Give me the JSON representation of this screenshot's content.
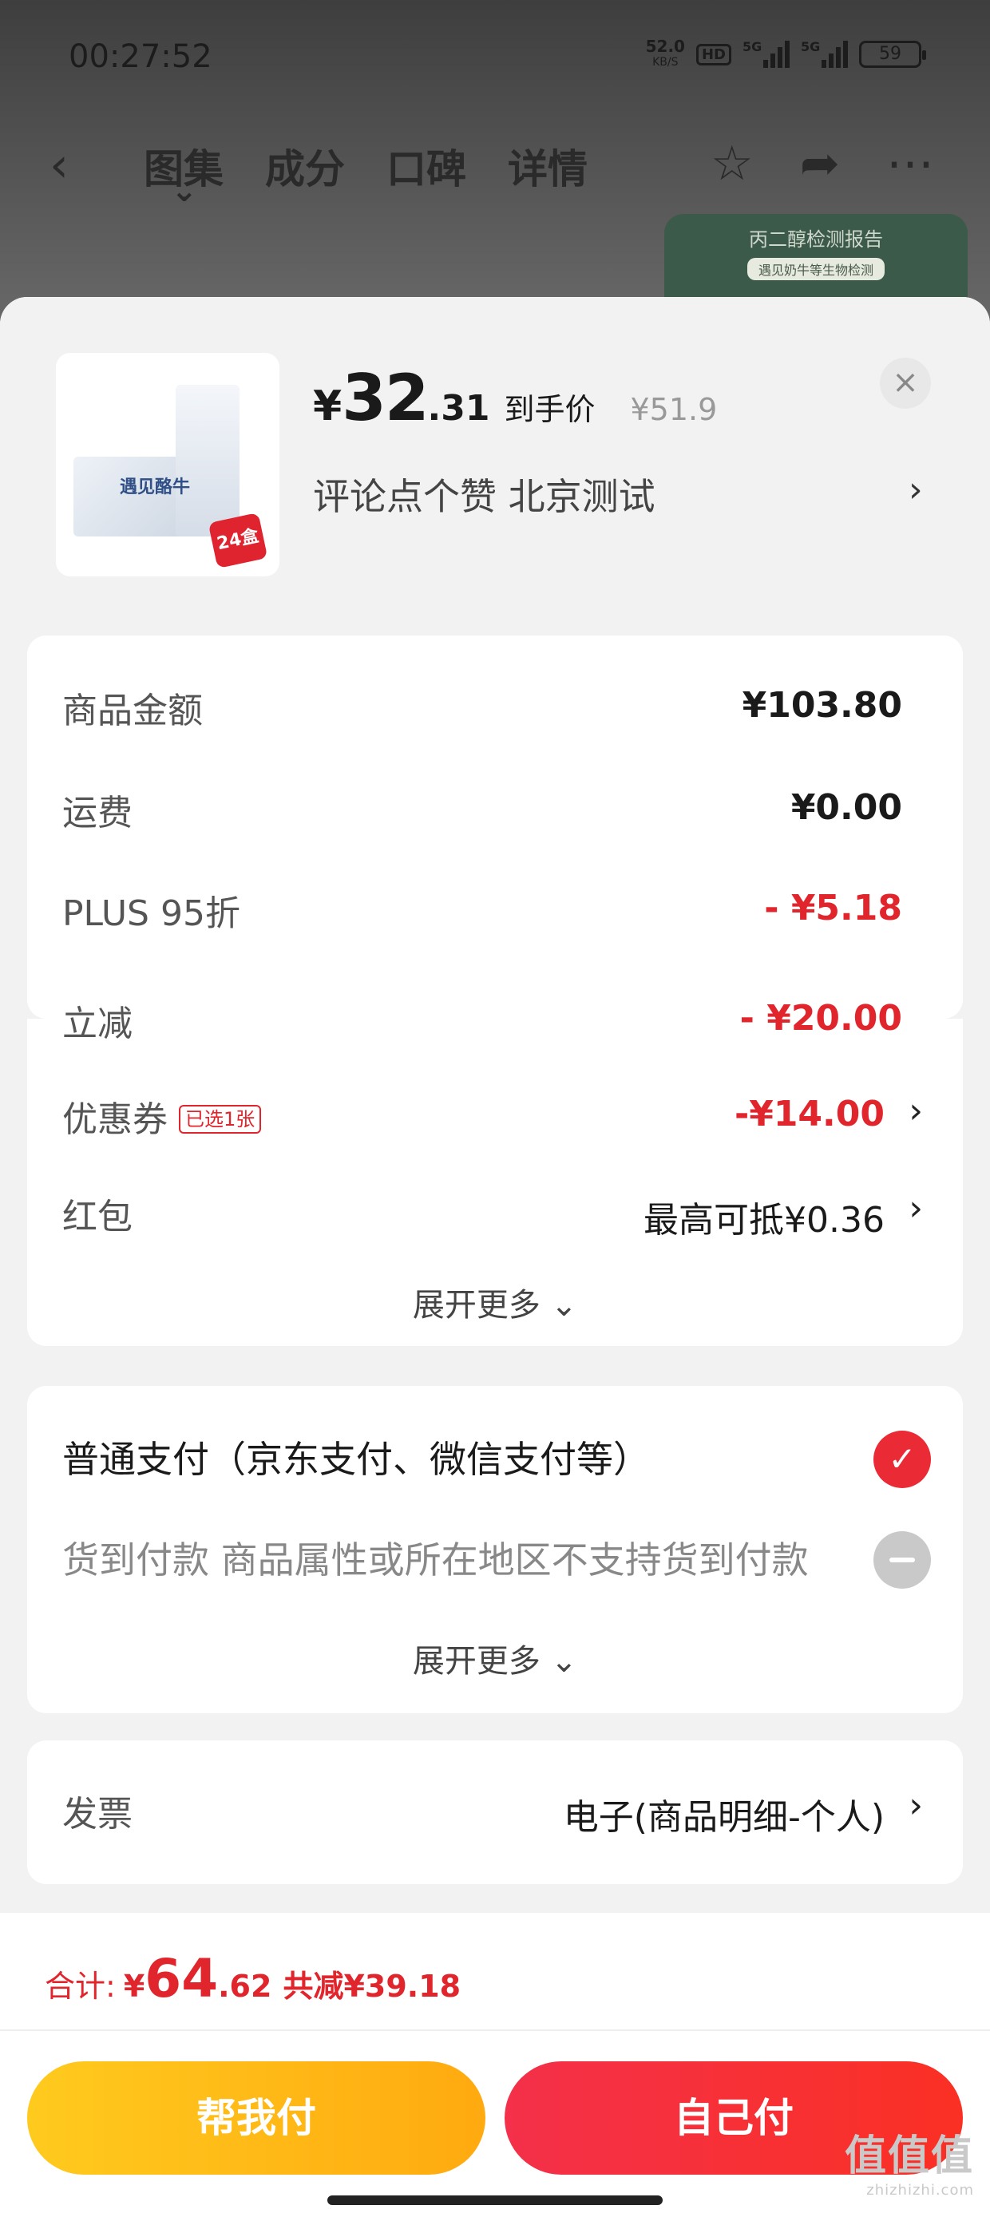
{
  "status_bar": {
    "time": "00:27:52",
    "speed_value": "52.0",
    "speed_unit": "KB/S",
    "hd_label": "HD",
    "signal1_label": "5G",
    "signal2_label": "5G",
    "battery": "59"
  },
  "nav": {
    "back_icon": "‹",
    "tabs": [
      "图集",
      "成分",
      "口碑",
      "详情"
    ],
    "active_tab": "图集",
    "icons": [
      "star-icon",
      "share-icon",
      "more-icon"
    ]
  },
  "report_card": {
    "title": "丙二醇检测报告",
    "subtitle": "遇见奶牛等生物检测"
  },
  "product": {
    "brand_text": "遇见酪牛",
    "pack_tag": "24盒",
    "price_currency": "¥",
    "price_int": "32",
    "price_dec": ".31",
    "price_label": "到手价",
    "original_price": "¥51.9",
    "subtitle": "评论点个赞  北京测试",
    "subtitle_arrow": "›",
    "close_icon": "×"
  },
  "amounts": {
    "rows": [
      {
        "label": "商品金额",
        "value": "¥103.80",
        "style": "normal"
      },
      {
        "label": "运费",
        "value": "¥0.00",
        "style": "normal"
      },
      {
        "label": "PLUS 95折",
        "value": "- ¥5.18",
        "style": "red"
      },
      {
        "label": "立减",
        "value": "- ¥20.00",
        "style": "red"
      },
      {
        "label": "优惠券",
        "tag": "已选1张",
        "value": "-¥14.00",
        "style": "red",
        "arrow": "›"
      },
      {
        "label": "红包",
        "value": "最高可抵¥0.36",
        "style": "plain",
        "arrow": "›"
      }
    ],
    "expand_label": "展开更多 ⌄"
  },
  "payment": {
    "options": [
      {
        "label": "普通支付（京东支付、微信支付等）",
        "selected": true,
        "disabled": false
      },
      {
        "label": "货到付款 商品属性或所在地区不支持货到付款",
        "selected": false,
        "disabled": true
      }
    ],
    "check_icon": "✓",
    "expand_label": "展开更多 ⌄"
  },
  "invoice": {
    "label": "发票",
    "value": "电子(商品明细-个人)",
    "arrow": "›"
  },
  "footer": {
    "total_label": "合计:",
    "total_currency": "¥",
    "total_int": "64",
    "total_dec": ".62",
    "total_saved": "共减¥39.18",
    "help_pay_label": "帮我付",
    "self_pay_label": "自己付"
  },
  "watermark": {
    "text": "值值值",
    "domain": "zhizhizhi.com"
  },
  "colors": {
    "accent_red": "#e0262c",
    "pay_selected": "#ea2b35",
    "help_btn": "#ffb414",
    "self_btn": "#f6302c"
  }
}
